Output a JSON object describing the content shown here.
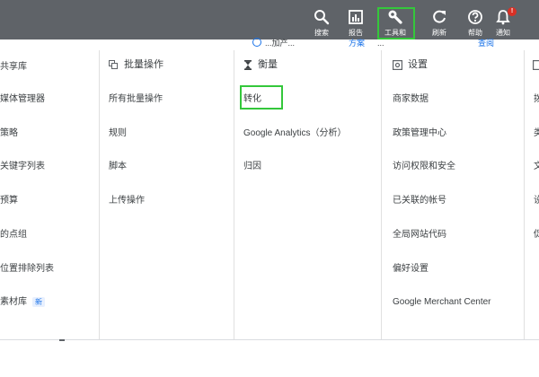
{
  "colors": {
    "topbar": "#5f6368",
    "highlight": "#34c73b",
    "link": "#1a73e8",
    "badge": "#d93025"
  },
  "toolbar": {
    "items": [
      {
        "id": "search",
        "label": "搜索",
        "icon": "search-icon"
      },
      {
        "id": "reports",
        "label": "报告",
        "icon": "bar-chart-icon"
      },
      {
        "id": "tools",
        "label": "工具和",
        "icon": "wrench-icon"
      },
      {
        "id": "refresh",
        "label": "刷新",
        "icon": "refresh-icon"
      },
      {
        "id": "help",
        "label": "帮助",
        "icon": "help-icon"
      },
      {
        "id": "notifications",
        "label": "通知",
        "icon": "bell-icon"
      }
    ],
    "notification_badge": "!"
  },
  "hint": {
    "text_a": "...加产...",
    "link_a": "方案",
    "text_b": "...",
    "link_b": "查阅"
  },
  "columns": [
    {
      "heading": "",
      "items": [
        "共享库",
        "媒体管理器",
        "策略",
        "关键字列表",
        "预算",
        "的点组",
        "位置排除列表",
        "素材库"
      ],
      "new_badge": "新"
    },
    {
      "heading": "批量操作",
      "icon": "bulk-actions-icon",
      "items": [
        "所有批量操作",
        "规则",
        "脚本",
        "上传操作"
      ]
    },
    {
      "heading": "衡量",
      "icon": "hourglass-icon",
      "items": [
        "转化",
        "Google Analytics（分析）",
        "归因"
      ]
    },
    {
      "heading": "设置",
      "icon": "settings-icon",
      "items": [
        "商家数据",
        "政策管理中心",
        "访问权限和安全",
        "已关联的帐号",
        "全局网站代码",
        "偏好设置",
        "Google Merchant Center"
      ]
    },
    {
      "heading": "",
      "items": [
        "拨",
        "类",
        "文",
        "设",
        "促"
      ]
    }
  ]
}
